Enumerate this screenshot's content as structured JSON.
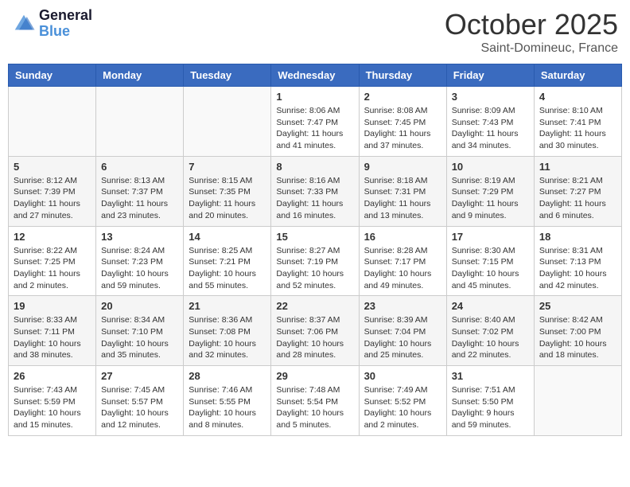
{
  "header": {
    "logo_line1": "General",
    "logo_line2": "Blue",
    "month": "October 2025",
    "location": "Saint-Domineuc, France"
  },
  "weekdays": [
    "Sunday",
    "Monday",
    "Tuesday",
    "Wednesday",
    "Thursday",
    "Friday",
    "Saturday"
  ],
  "weeks": [
    [
      {
        "day": "",
        "info": ""
      },
      {
        "day": "",
        "info": ""
      },
      {
        "day": "",
        "info": ""
      },
      {
        "day": "1",
        "info": "Sunrise: 8:06 AM\nSunset: 7:47 PM\nDaylight: 11 hours\nand 41 minutes."
      },
      {
        "day": "2",
        "info": "Sunrise: 8:08 AM\nSunset: 7:45 PM\nDaylight: 11 hours\nand 37 minutes."
      },
      {
        "day": "3",
        "info": "Sunrise: 8:09 AM\nSunset: 7:43 PM\nDaylight: 11 hours\nand 34 minutes."
      },
      {
        "day": "4",
        "info": "Sunrise: 8:10 AM\nSunset: 7:41 PM\nDaylight: 11 hours\nand 30 minutes."
      }
    ],
    [
      {
        "day": "5",
        "info": "Sunrise: 8:12 AM\nSunset: 7:39 PM\nDaylight: 11 hours\nand 27 minutes."
      },
      {
        "day": "6",
        "info": "Sunrise: 8:13 AM\nSunset: 7:37 PM\nDaylight: 11 hours\nand 23 minutes."
      },
      {
        "day": "7",
        "info": "Sunrise: 8:15 AM\nSunset: 7:35 PM\nDaylight: 11 hours\nand 20 minutes."
      },
      {
        "day": "8",
        "info": "Sunrise: 8:16 AM\nSunset: 7:33 PM\nDaylight: 11 hours\nand 16 minutes."
      },
      {
        "day": "9",
        "info": "Sunrise: 8:18 AM\nSunset: 7:31 PM\nDaylight: 11 hours\nand 13 minutes."
      },
      {
        "day": "10",
        "info": "Sunrise: 8:19 AM\nSunset: 7:29 PM\nDaylight: 11 hours\nand 9 minutes."
      },
      {
        "day": "11",
        "info": "Sunrise: 8:21 AM\nSunset: 7:27 PM\nDaylight: 11 hours\nand 6 minutes."
      }
    ],
    [
      {
        "day": "12",
        "info": "Sunrise: 8:22 AM\nSunset: 7:25 PM\nDaylight: 11 hours\nand 2 minutes."
      },
      {
        "day": "13",
        "info": "Sunrise: 8:24 AM\nSunset: 7:23 PM\nDaylight: 10 hours\nand 59 minutes."
      },
      {
        "day": "14",
        "info": "Sunrise: 8:25 AM\nSunset: 7:21 PM\nDaylight: 10 hours\nand 55 minutes."
      },
      {
        "day": "15",
        "info": "Sunrise: 8:27 AM\nSunset: 7:19 PM\nDaylight: 10 hours\nand 52 minutes."
      },
      {
        "day": "16",
        "info": "Sunrise: 8:28 AM\nSunset: 7:17 PM\nDaylight: 10 hours\nand 49 minutes."
      },
      {
        "day": "17",
        "info": "Sunrise: 8:30 AM\nSunset: 7:15 PM\nDaylight: 10 hours\nand 45 minutes."
      },
      {
        "day": "18",
        "info": "Sunrise: 8:31 AM\nSunset: 7:13 PM\nDaylight: 10 hours\nand 42 minutes."
      }
    ],
    [
      {
        "day": "19",
        "info": "Sunrise: 8:33 AM\nSunset: 7:11 PM\nDaylight: 10 hours\nand 38 minutes."
      },
      {
        "day": "20",
        "info": "Sunrise: 8:34 AM\nSunset: 7:10 PM\nDaylight: 10 hours\nand 35 minutes."
      },
      {
        "day": "21",
        "info": "Sunrise: 8:36 AM\nSunset: 7:08 PM\nDaylight: 10 hours\nand 32 minutes."
      },
      {
        "day": "22",
        "info": "Sunrise: 8:37 AM\nSunset: 7:06 PM\nDaylight: 10 hours\nand 28 minutes."
      },
      {
        "day": "23",
        "info": "Sunrise: 8:39 AM\nSunset: 7:04 PM\nDaylight: 10 hours\nand 25 minutes."
      },
      {
        "day": "24",
        "info": "Sunrise: 8:40 AM\nSunset: 7:02 PM\nDaylight: 10 hours\nand 22 minutes."
      },
      {
        "day": "25",
        "info": "Sunrise: 8:42 AM\nSunset: 7:00 PM\nDaylight: 10 hours\nand 18 minutes."
      }
    ],
    [
      {
        "day": "26",
        "info": "Sunrise: 7:43 AM\nSunset: 5:59 PM\nDaylight: 10 hours\nand 15 minutes."
      },
      {
        "day": "27",
        "info": "Sunrise: 7:45 AM\nSunset: 5:57 PM\nDaylight: 10 hours\nand 12 minutes."
      },
      {
        "day": "28",
        "info": "Sunrise: 7:46 AM\nSunset: 5:55 PM\nDaylight: 10 hours\nand 8 minutes."
      },
      {
        "day": "29",
        "info": "Sunrise: 7:48 AM\nSunset: 5:54 PM\nDaylight: 10 hours\nand 5 minutes."
      },
      {
        "day": "30",
        "info": "Sunrise: 7:49 AM\nSunset: 5:52 PM\nDaylight: 10 hours\nand 2 minutes."
      },
      {
        "day": "31",
        "info": "Sunrise: 7:51 AM\nSunset: 5:50 PM\nDaylight: 9 hours\nand 59 minutes."
      },
      {
        "day": "",
        "info": ""
      }
    ]
  ]
}
